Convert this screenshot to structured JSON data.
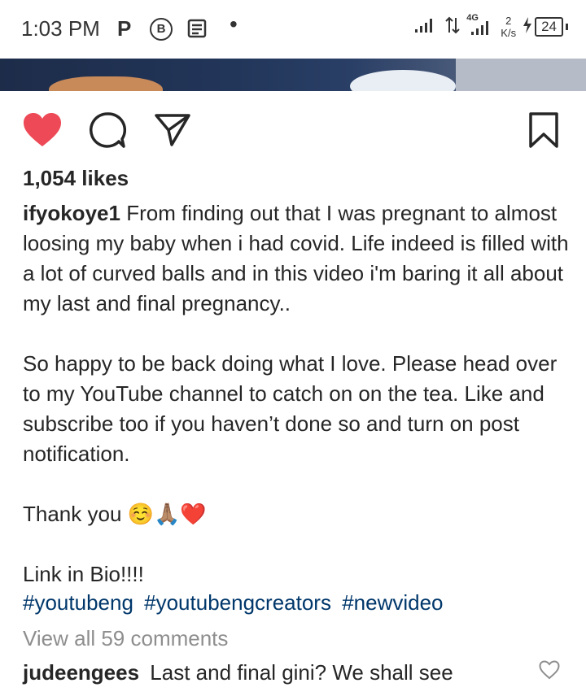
{
  "status_bar": {
    "time": "1:03 PM",
    "p_icon_text": "P",
    "b_icon_text": "B",
    "network": "4G",
    "speed_value": "2",
    "speed_unit": "K/s",
    "battery": "24"
  },
  "post": {
    "likes": "1,054 likes",
    "username": "ifyokoye1",
    "caption_first": "From finding out that I was pregnant to almost loosing my baby when i had covid. Life indeed is filled with a lot of curved balls and in this video i'm baring it all about my last and final pregnancy..",
    "caption_second": "So happy to be back doing what I love. Please head over to my YouTube channel to catch on on the tea. Like and subscribe too if you haven’t done so and turn on post notification.",
    "caption_thanks": "Thank you ☺️🙏🏽❤️",
    "caption_link": "Link in Bio!!!!",
    "hashtags": [
      "#youtubeng",
      "#youtubengcreators",
      "#newvideo"
    ],
    "view_comments": "View all 59 comments",
    "preview_comment": {
      "username": "judeengees",
      "text": "Last and final gini? We shall see"
    }
  },
  "icons": {
    "like": "heart-icon",
    "comment": "comment-icon",
    "share": "share-icon",
    "save": "bookmark-icon",
    "comment_like": "heart-outline-icon"
  },
  "colors": {
    "like_red": "#ed4956",
    "hashtag_blue": "#00376b",
    "muted_gray": "#8e8e8e"
  }
}
